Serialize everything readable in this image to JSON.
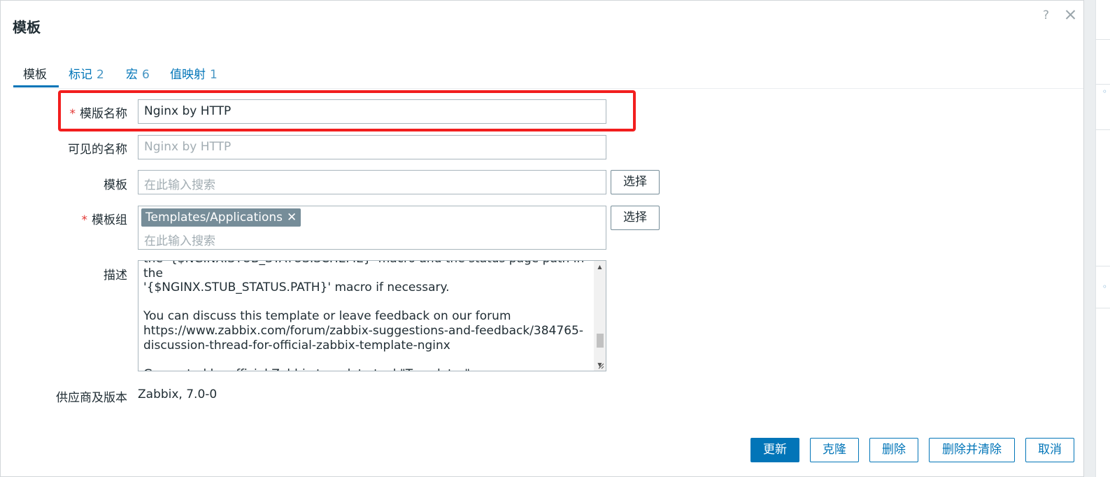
{
  "dialog": {
    "title": "模板",
    "help": "?"
  },
  "tabs": [
    {
      "label": "模板",
      "count": ""
    },
    {
      "label": "标记",
      "count": "2"
    },
    {
      "label": "宏",
      "count": "6"
    },
    {
      "label": "值映射",
      "count": "1"
    }
  ],
  "form": {
    "template_name": {
      "label": "模版名称",
      "required": "*",
      "value": "Nginx by HTTP"
    },
    "visible_name": {
      "label": "可见的名称",
      "placeholder": "Nginx by HTTP"
    },
    "templates": {
      "label": "模板",
      "placeholder": "在此输入搜索",
      "button": "选择"
    },
    "template_groups": {
      "label": "模板组",
      "required": "*",
      "chip": "Templates/Applications",
      "placeholder": "在此输入搜索",
      "button": "选择"
    },
    "description": {
      "label": "描述",
      "text": "the '{$NGINX.STUB_STATUS.SCHEME}' macro and the status page path in the\n'{$NGINX.STUB_STATUS.PATH}' macro if necessary.\n\nYou can discuss this template or leave feedback on our forum\nhttps://www.zabbix.com/forum/zabbix-suggestions-and-feedback/384765-\ndiscussion-thread-for-official-zabbix-template-nginx\n\nGenerated by official Zabbix template tool \"Templator\""
    },
    "vendor": {
      "label": "供应商及版本",
      "value": "Zabbix, 7.0-0"
    }
  },
  "footer": {
    "update": "更新",
    "clone": "克隆",
    "delete": "删除",
    "delete_clear": "删除并清除",
    "cancel": "取消"
  },
  "colors": {
    "accent": "#0275b8",
    "highlight": "#f21e1e",
    "required": "#e33734"
  }
}
